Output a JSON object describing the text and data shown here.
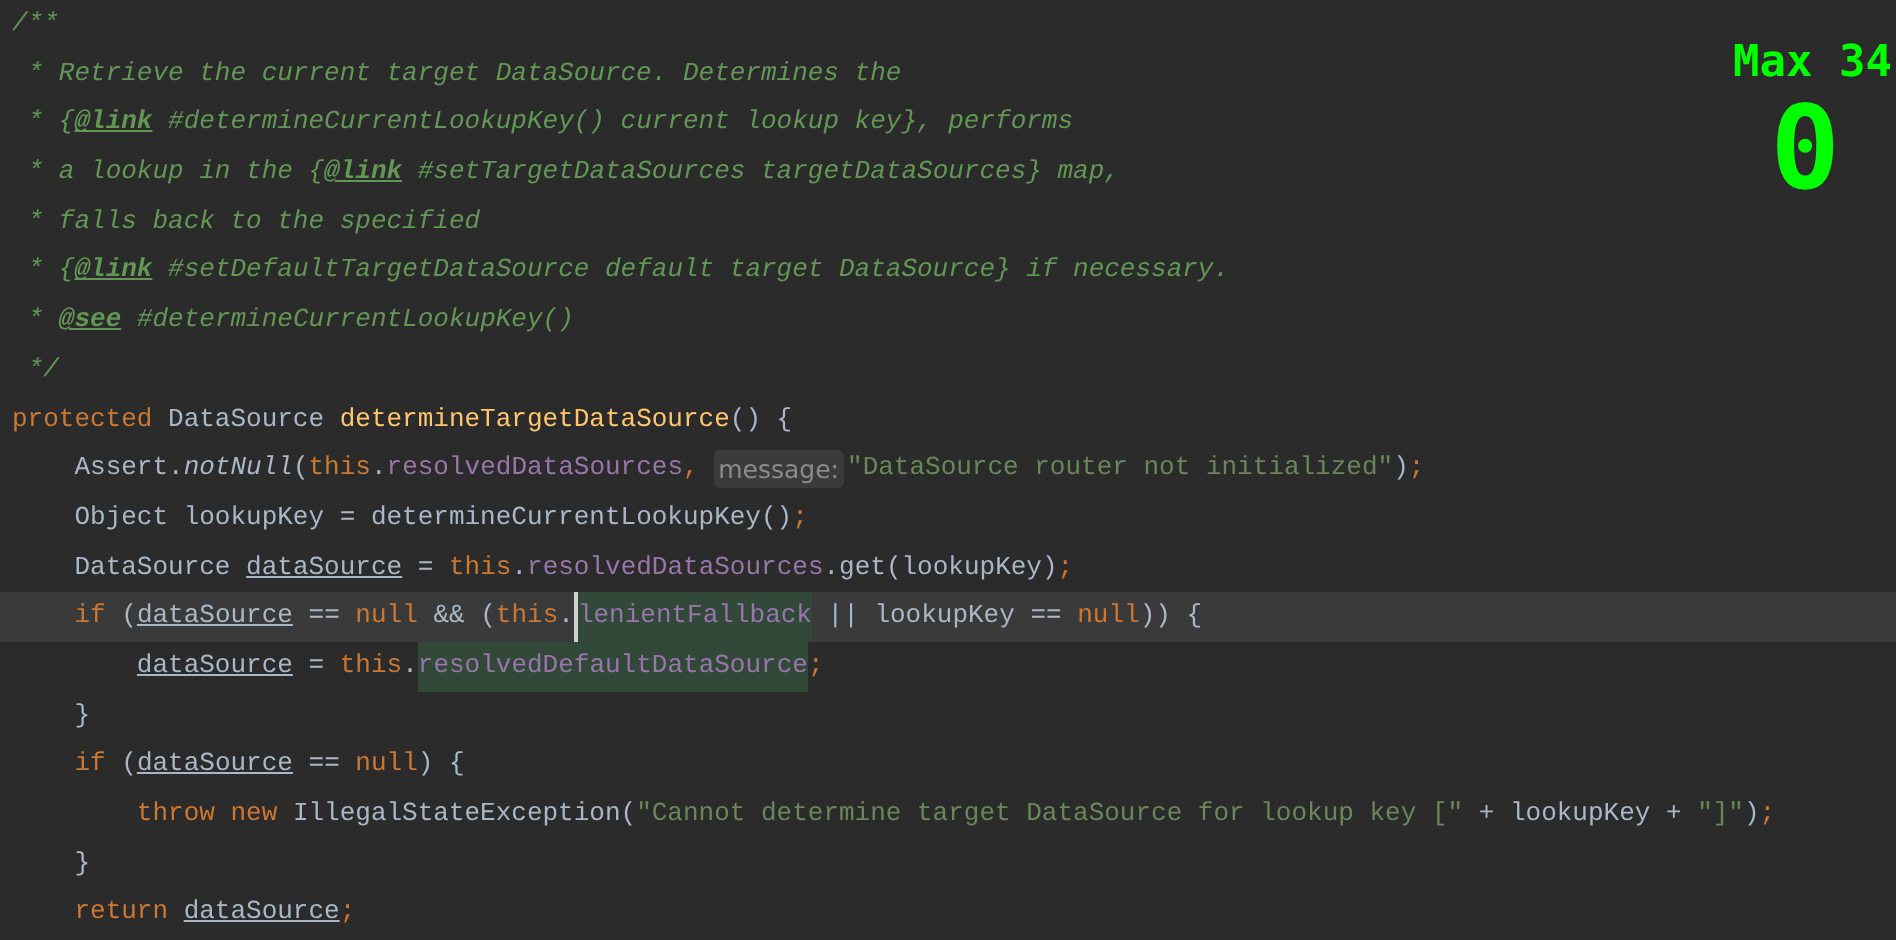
{
  "editor": {
    "lines": [
      {
        "current": false,
        "tokens": [
          {
            "t": "/**",
            "kind": "c"
          }
        ]
      },
      {
        "current": false,
        "tokens": [
          {
            "t": " * Retrieve the current target DataSource. Determines the",
            "kind": "c"
          }
        ]
      },
      {
        "current": false,
        "tokens": [
          {
            "t": " * {",
            "kind": "c"
          },
          {
            "t": "@link",
            "kind": "tag"
          },
          {
            "t": " #determineCurrentLookupKey() current lookup key}, performs",
            "kind": "c"
          }
        ]
      },
      {
        "current": false,
        "tokens": [
          {
            "t": " * a lookup in the {",
            "kind": "c"
          },
          {
            "t": "@link",
            "kind": "tag"
          },
          {
            "t": " #setTargetDataSources targetDataSources} map,",
            "kind": "c"
          }
        ]
      },
      {
        "current": false,
        "tokens": [
          {
            "t": " * falls back to the specified",
            "kind": "c"
          }
        ]
      },
      {
        "current": false,
        "tokens": [
          {
            "t": " * {",
            "kind": "c"
          },
          {
            "t": "@link",
            "kind": "tag"
          },
          {
            "t": " #setDefaultTargetDataSource default target DataSource} if necessary.",
            "kind": "c"
          }
        ]
      },
      {
        "current": false,
        "tokens": [
          {
            "t": " * ",
            "kind": "c"
          },
          {
            "t": "@see",
            "kind": "tag"
          },
          {
            "t": " #determineCurrentLookupKey()",
            "kind": "c"
          }
        ]
      },
      {
        "current": false,
        "tokens": [
          {
            "t": " */",
            "kind": "c"
          }
        ]
      },
      {
        "current": false,
        "tokens": [
          {
            "t": "protected ",
            "kind": "kw"
          },
          {
            "t": "DataSource ",
            "kind": "plain"
          },
          {
            "t": "determineTargetDataSource",
            "kind": "method"
          },
          {
            "t": "() {",
            "kind": "plain"
          }
        ]
      },
      {
        "current": false,
        "tokens": [
          {
            "t": "    Assert.",
            "kind": "plain"
          },
          {
            "t": "notNull",
            "kind": "static"
          },
          {
            "t": "(",
            "kind": "plain"
          },
          {
            "t": "this",
            "kind": "kw"
          },
          {
            "t": ".",
            "kind": "plain"
          },
          {
            "t": "resolvedDataSources",
            "kind": "field"
          },
          {
            "t": ", ",
            "kind": "kw"
          },
          {
            "t": "message:",
            "kind": "hint"
          },
          {
            "t": "\"DataSource router not initialized\"",
            "kind": "str"
          },
          {
            "t": ")",
            "kind": "plain"
          },
          {
            "t": ";",
            "kind": "kw"
          }
        ]
      },
      {
        "current": false,
        "tokens": [
          {
            "t": "    Object lookupKey = determineCurrentLookupKey()",
            "kind": "plain"
          },
          {
            "t": ";",
            "kind": "kw"
          }
        ]
      },
      {
        "current": false,
        "tokens": [
          {
            "t": "    DataSource ",
            "kind": "plain"
          },
          {
            "t": "dataSource",
            "kind": "var"
          },
          {
            "t": " = ",
            "kind": "plain"
          },
          {
            "t": "this",
            "kind": "kw"
          },
          {
            "t": ".",
            "kind": "plain"
          },
          {
            "t": "resolvedDataSources",
            "kind": "field"
          },
          {
            "t": ".get(lookupKey)",
            "kind": "plain"
          },
          {
            "t": ";",
            "kind": "kw"
          }
        ]
      },
      {
        "current": true,
        "tokens": [
          {
            "t": "    if ",
            "kind": "kw"
          },
          {
            "t": "(",
            "kind": "plain"
          },
          {
            "t": "dataSource",
            "kind": "var"
          },
          {
            "t": " == ",
            "kind": "plain"
          },
          {
            "t": "null",
            "kind": "kw"
          },
          {
            "t": " && (",
            "kind": "plain"
          },
          {
            "t": "this",
            "kind": "kw"
          },
          {
            "t": ".",
            "kind": "plain"
          },
          {
            "t": "lenientFallback",
            "kind": "hl",
            "caret": true
          },
          {
            "t": " || lookupKey == ",
            "kind": "plain"
          },
          {
            "t": "null",
            "kind": "kw"
          },
          {
            "t": ")) {",
            "kind": "plain"
          }
        ]
      },
      {
        "current": false,
        "tokens": [
          {
            "t": "        dataSource",
            "kind": "var"
          },
          {
            "t": " = ",
            "kind": "plain"
          },
          {
            "t": "this",
            "kind": "kw"
          },
          {
            "t": ".",
            "kind": "plain"
          },
          {
            "t": "resolvedDefaultDataSource",
            "kind": "hl",
            "caret": false
          },
          {
            "t": ";",
            "kind": "kw"
          }
        ]
      },
      {
        "current": false,
        "tokens": [
          {
            "t": "    }",
            "kind": "plain"
          }
        ]
      },
      {
        "current": false,
        "tokens": [
          {
            "t": "    if ",
            "kind": "kw"
          },
          {
            "t": "(",
            "kind": "plain"
          },
          {
            "t": "dataSource",
            "kind": "var"
          },
          {
            "t": " == ",
            "kind": "plain"
          },
          {
            "t": "null",
            "kind": "kw"
          },
          {
            "t": ") {",
            "kind": "plain"
          }
        ]
      },
      {
        "current": false,
        "tokens": [
          {
            "t": "        throw new ",
            "kind": "kw"
          },
          {
            "t": "IllegalStateException(",
            "kind": "plain"
          },
          {
            "t": "\"Cannot determine target DataSource for lookup key [\"",
            "kind": "str"
          },
          {
            "t": " + lookupKey + ",
            "kind": "plain"
          },
          {
            "t": "\"]\"",
            "kind": "str"
          },
          {
            "t": ")",
            "kind": "plain"
          },
          {
            "t": ";",
            "kind": "kw"
          }
        ]
      },
      {
        "current": false,
        "tokens": [
          {
            "t": "    }",
            "kind": "plain"
          }
        ]
      },
      {
        "current": false,
        "tokens": [
          {
            "t": "    return ",
            "kind": "kw"
          },
          {
            "t": "dataSource",
            "kind": "var"
          },
          {
            "t": ";",
            "kind": "kw"
          }
        ]
      }
    ]
  },
  "combo_counter": {
    "max_label": "Max 34",
    "count": "0"
  }
}
